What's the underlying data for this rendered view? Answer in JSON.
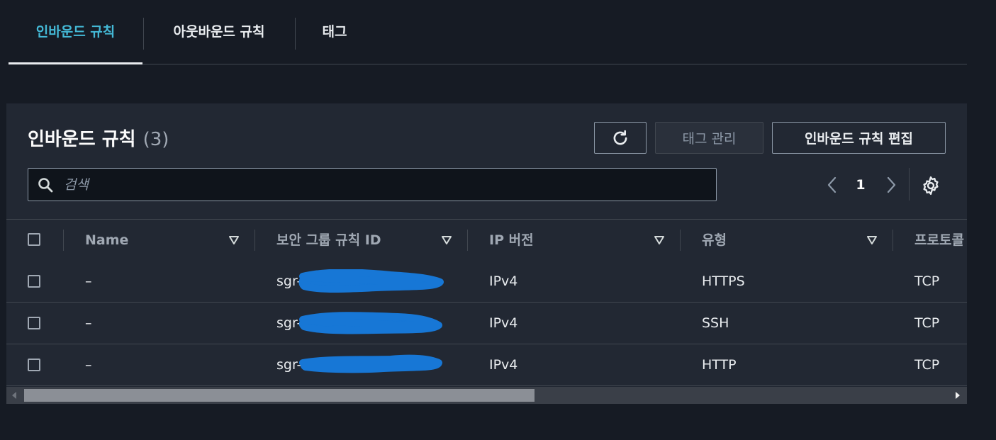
{
  "tabs": [
    {
      "label": "인바운드 규칙",
      "active": true
    },
    {
      "label": "아웃바운드 규칙",
      "active": false
    },
    {
      "label": "태그",
      "active": false
    }
  ],
  "panel": {
    "title": "인바운드 규칙",
    "count": "(3)",
    "buttons": {
      "refresh_icon": "refresh-icon",
      "manage_tags": "태그 관리",
      "edit_rules": "인바운드 규칙 편집"
    }
  },
  "search": {
    "placeholder": "검색",
    "value": ""
  },
  "pagination": {
    "current_page": "1"
  },
  "table": {
    "columns": [
      "Name",
      "보안 그룹 규칙 ID",
      "IP 버전",
      "유형",
      "프로토콜"
    ],
    "rows": [
      {
        "name": "–",
        "rule_id": "sgr-",
        "ip_version": "IPv4",
        "type": "HTTPS",
        "protocol": "TCP"
      },
      {
        "name": "–",
        "rule_id": "sgr-",
        "ip_version": "IPv4",
        "type": "SSH",
        "protocol": "TCP"
      },
      {
        "name": "–",
        "rule_id": "sgr-",
        "ip_version": "IPv4",
        "type": "HTTP",
        "protocol": "TCP"
      }
    ]
  },
  "colors": {
    "background": "#161b24",
    "panel": "#222833",
    "active_tab": "#44b9d6",
    "redaction": "#1777d6"
  }
}
